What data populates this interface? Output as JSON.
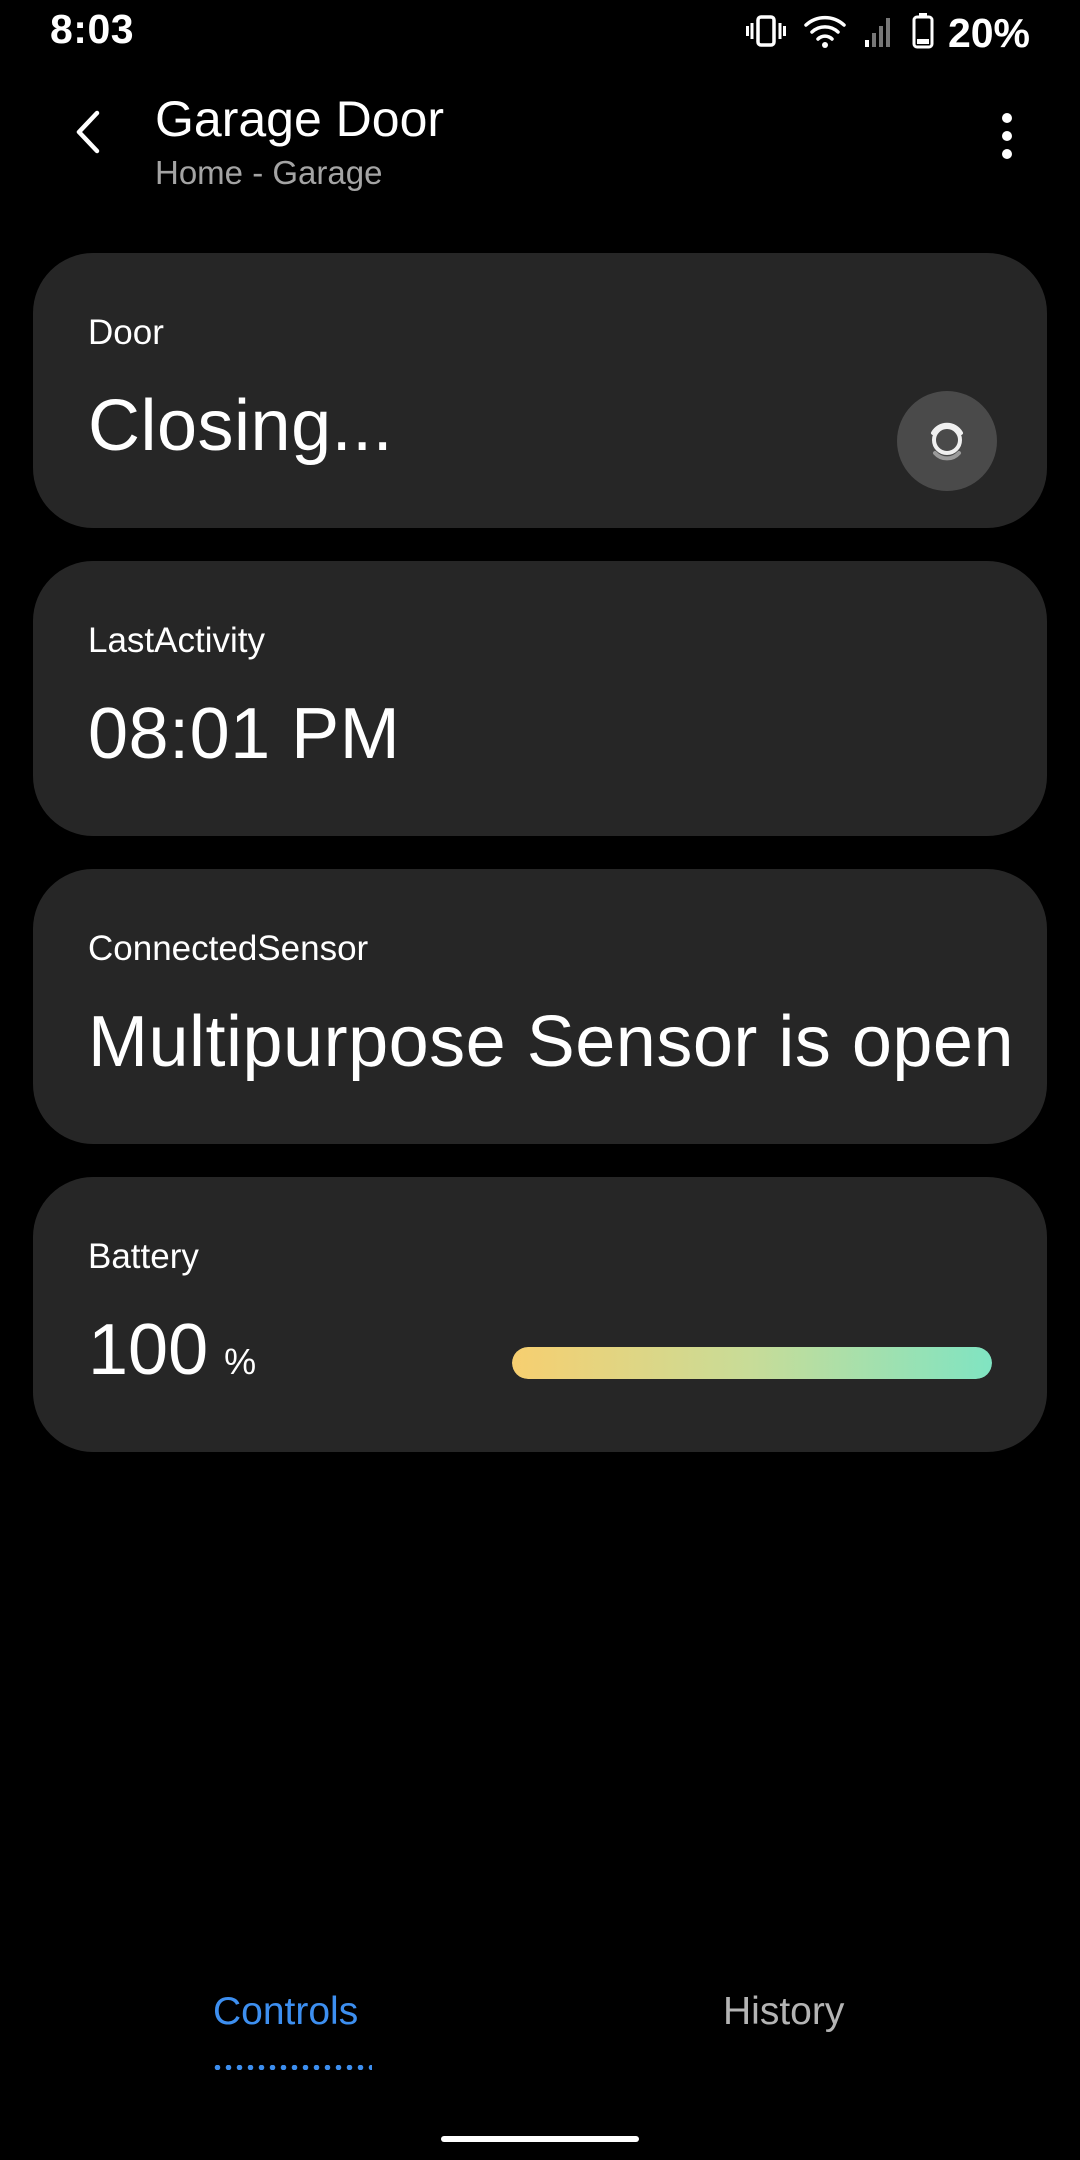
{
  "status_bar": {
    "time": "8:03",
    "battery_percent": "20%",
    "icons": [
      "vibrate-icon",
      "wifi-icon",
      "signal-icon",
      "battery-icon"
    ]
  },
  "header": {
    "title": "Garage Door",
    "breadcrumb": "Home - Garage",
    "back_icon": "chevron-left-icon",
    "menu_icon": "more-vertical-icon"
  },
  "cards": {
    "door": {
      "label": "Door",
      "value": "Closing...",
      "action_icon": "door-toggle-icon"
    },
    "last_activity": {
      "label": "LastActivity",
      "value": "08:01 PM"
    },
    "connected_sensor": {
      "label": "ConnectedSensor",
      "value": "Multipurpose Sensor is open"
    },
    "battery": {
      "label": "Battery",
      "value": "100",
      "unit": "%",
      "level_percent": 100
    }
  },
  "tabs": [
    {
      "label": "Controls",
      "active": true
    },
    {
      "label": "History",
      "active": false
    }
  ],
  "colors": {
    "background": "#000000",
    "card": "#262626",
    "accent": "#3d8ff0",
    "secondary_text": "#a4a4a4",
    "battery_gradient_start": "#f7cf70",
    "battery_gradient_end": "#80e4c2"
  }
}
